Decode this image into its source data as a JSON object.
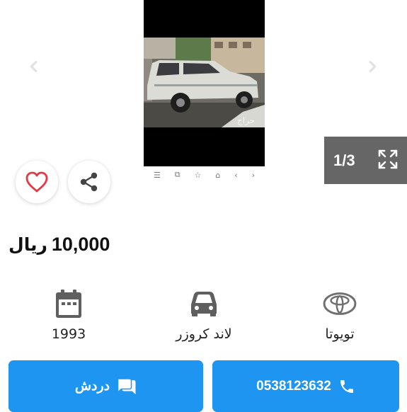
{
  "gallery": {
    "counter": "1/3",
    "photo_watermark": "حراج",
    "browser_bar": [
      "☰",
      "⧉",
      "☆",
      "⌂",
      "‹",
      "›"
    ]
  },
  "listing": {
    "price_value": "10,000",
    "price_currency": "ريال"
  },
  "specs": {
    "year": "1993",
    "model": "لاند كروزر",
    "make": "تويوتا"
  },
  "actions": {
    "chat_label": "دردش",
    "phone_label": "0538123632"
  },
  "colors": {
    "accent": "#1e95f0",
    "heart": "#e53945",
    "counter_bg": "#555555"
  }
}
